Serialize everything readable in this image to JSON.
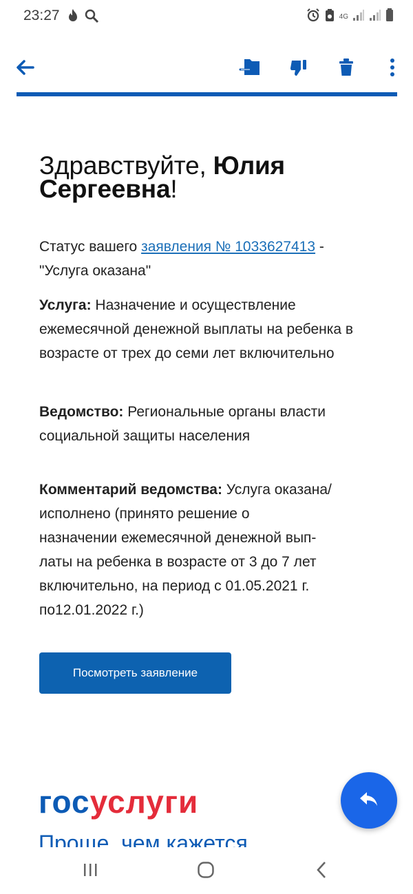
{
  "status_bar": {
    "time": "23:27",
    "network": "4G",
    "icons_left": [
      "flame-icon",
      "search-icon"
    ],
    "icons_right": [
      "alarm-icon",
      "battery-saver-icon",
      "signal-icon",
      "signal-icon",
      "battery-icon"
    ]
  },
  "toolbar": {
    "back_icon": "arrow-left-icon",
    "actions": [
      "move-to-folder-icon",
      "thumbs-down-icon",
      "trash-icon",
      "more-vert-icon"
    ],
    "accent": "#0d5bb5"
  },
  "email": {
    "greeting_prefix": "Здравствуйте, ",
    "greeting_name_1": "Юлия",
    "greeting_name_2": "Сергеевна",
    "greeting_suffix": "!",
    "status_prefix": "Статус вашего ",
    "status_link": "заявления № 1033627413",
    "status_suffix_1": " -",
    "status_suffix_2": "\"Услуга оказана\"",
    "service_label": "Услуга:",
    "service_value": " Назначение и осуществление ежемесячной денежной выплаты на ребенка в возрасте от трех до семи лет включительно",
    "dept_label": "Ведомство:",
    "dept_value": " Региональные органы власти социальной защиты населения",
    "comment_label": "Комментарий ведомства:",
    "comment_line_1": " Услуга оказана/",
    "comment_line_2": "исполнено (принято решение о",
    "comment_line_3": "назначении ежемесячной денежной вып-",
    "comment_line_4": "латы на ребенка в возрасте от 3 до 7 лет",
    "comment_line_5": "включительно, на период с 01.05.2021 г.",
    "comment_line_6": "по12.01.2022 г.)",
    "button_label": "Посмотреть заявление",
    "button_color": "#0d62b0"
  },
  "brand": {
    "logo_part_1": "гос",
    "logo_part_2": "услуги",
    "slogan": "Проще, чем кажется",
    "blue": "#0d5bb5",
    "red": "#e42c3a"
  },
  "fab": {
    "icon": "reply-icon",
    "color": "#1a66e8"
  },
  "nav_bar": {
    "buttons": [
      "recent-apps-icon",
      "home-icon",
      "back-icon"
    ]
  }
}
